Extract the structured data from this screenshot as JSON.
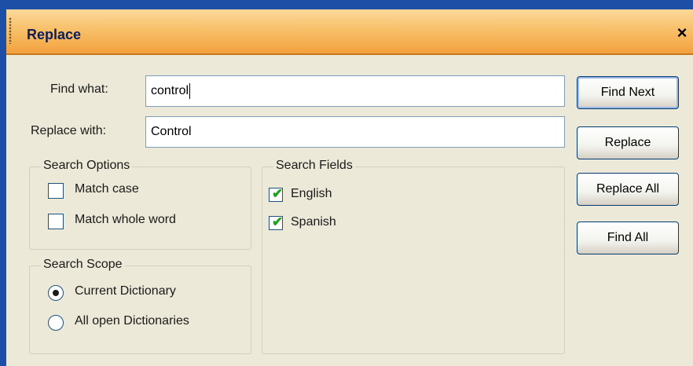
{
  "window": {
    "title": "Replace",
    "close_glyph": "×"
  },
  "find": {
    "label": "Find what:",
    "value": "control"
  },
  "replace": {
    "label": "Replace with:",
    "value": "Control"
  },
  "buttons": {
    "find_next": "Find Next",
    "replace": "Replace",
    "replace_all": "Replace All",
    "find_all": "Find All"
  },
  "search_options": {
    "title": "Search Options",
    "match_case": {
      "label": "Match case",
      "checked": false
    },
    "match_whole_word": {
      "label": "Match whole word",
      "checked": false
    }
  },
  "search_fields": {
    "title": "Search Fields",
    "english": {
      "label": "English",
      "checked": true
    },
    "spanish": {
      "label": "Spanish",
      "checked": true
    }
  },
  "search_scope": {
    "title": "Search Scope",
    "current_dictionary": {
      "label": "Current Dictionary",
      "selected": true
    },
    "all_open_dictionaries": {
      "label": "All open Dictionaries",
      "selected": false
    }
  },
  "colors": {
    "titlebar_accent": "#f3a23e",
    "frame_blue": "#1c4fa5",
    "dialog_background": "#ece9d8",
    "check_green": "#21a121"
  },
  "icons": {
    "close": "close-icon",
    "grip": "grip-icon",
    "check": "checkmark-icon"
  }
}
